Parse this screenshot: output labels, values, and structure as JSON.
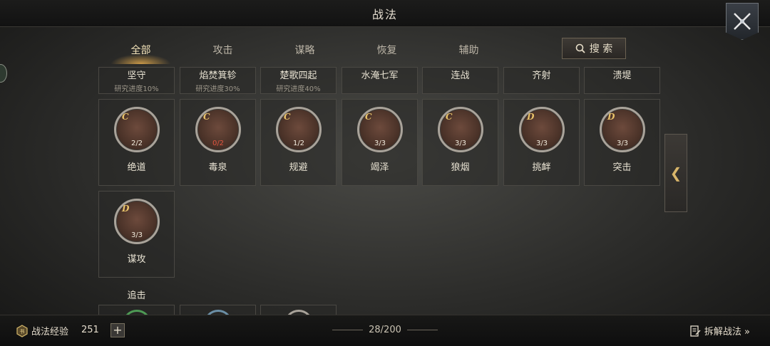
{
  "header": {
    "title": "战法"
  },
  "icons": {
    "close": "crossed-swords-close-icon",
    "search": "search-icon",
    "expand": "chevron-left-icon",
    "exp": "exp-book-icon",
    "dismantle": "dismantle-document-icon"
  },
  "tabs": [
    {
      "label": "全部",
      "active": true
    },
    {
      "label": "攻击",
      "active": false
    },
    {
      "label": "谋略",
      "active": false
    },
    {
      "label": "恢复",
      "active": false
    },
    {
      "label": "辅助",
      "active": false
    }
  ],
  "search": {
    "label": "搜 索"
  },
  "top_row": [
    {
      "name": "坚守",
      "progress": "研究进度10%"
    },
    {
      "name": "焰焚箕轸",
      "progress": "研究进度30%"
    },
    {
      "name": "楚歌四起",
      "progress": "研究进度40%"
    },
    {
      "name": "水淹七军",
      "progress": ""
    },
    {
      "name": "连战",
      "progress": ""
    },
    {
      "name": "齐射",
      "progress": ""
    },
    {
      "name": "溃堤",
      "progress": ""
    }
  ],
  "skills": [
    {
      "name": "绝道",
      "grade": "C",
      "count": "2/2",
      "count_color": "normal"
    },
    {
      "name": "毒泉",
      "grade": "C",
      "count": "0/2",
      "count_color": "red"
    },
    {
      "name": "规避",
      "grade": "C",
      "count": "1/2",
      "count_color": "normal"
    },
    {
      "name": "竭泽",
      "grade": "C",
      "count": "3/3",
      "count_color": "normal"
    },
    {
      "name": "狼烟",
      "grade": "C",
      "count": "3/3",
      "count_color": "normal"
    },
    {
      "name": "挑衅",
      "grade": "D",
      "count": "3/3",
      "count_color": "normal"
    },
    {
      "name": "突击",
      "grade": "D",
      "count": "3/3",
      "count_color": "normal"
    },
    {
      "name": "谋攻",
      "grade": "D",
      "count": "3/3",
      "count_color": "normal"
    }
  ],
  "next_section": {
    "title": "追击"
  },
  "footer": {
    "exp_label": "战法经验",
    "exp_value": "251",
    "plus": "+",
    "capacity": "28/200",
    "dismantle_label": "拆解战法 »"
  },
  "colors": {
    "accent_gold": "#e9c36a",
    "count_red": "#e0533e"
  }
}
